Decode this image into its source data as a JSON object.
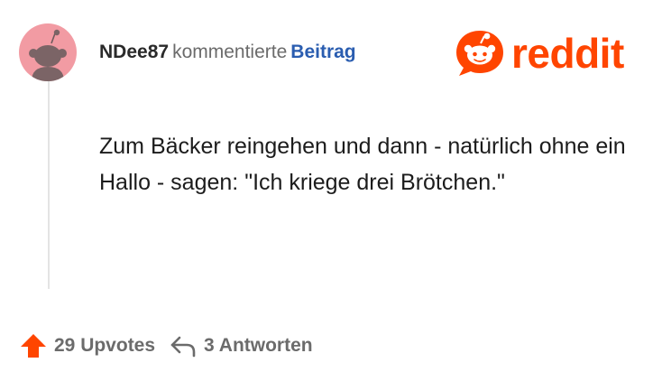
{
  "header": {
    "username": "NDee87",
    "action_text": "kommentierte",
    "target_link": "Beitrag"
  },
  "logo": {
    "wordmark": "reddit",
    "brand_color": "#ff4500"
  },
  "comment": {
    "text": "Zum Bäcker reingehen und dann - natürlich ohne ein Hallo - sagen: \"Ich kriege drei Brötchen.\""
  },
  "footer": {
    "upvotes_label": "29 Upvotes",
    "replies_label": "3 Antworten"
  },
  "icons": {
    "avatar": "snoo-avatar-icon",
    "logo": "snoo-logo-icon",
    "upvote": "upvote-arrow-icon",
    "reply": "reply-arrow-icon"
  },
  "colors": {
    "avatar_bg": "#f29ba3",
    "link": "#2a5db0",
    "upvote": "#ff4500",
    "muted": "#6b6b6b"
  }
}
